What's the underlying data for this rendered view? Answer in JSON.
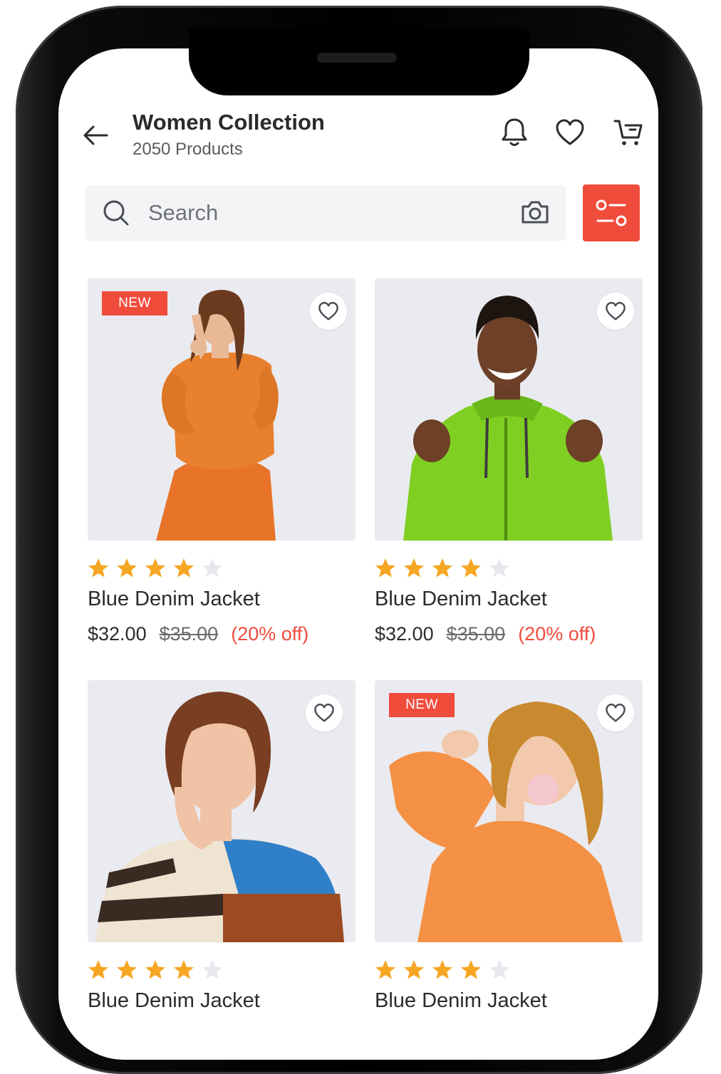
{
  "header": {
    "title": "Women Collection",
    "subtitle": "2050 Products",
    "icons": [
      "back-arrow-icon",
      "bell-icon",
      "heart-icon",
      "cart-icon"
    ]
  },
  "search": {
    "placeholder": "Search",
    "value": "",
    "icons": [
      "search-icon",
      "camera-icon",
      "filter-icon"
    ]
  },
  "colors": {
    "accent": "#f04c3c",
    "star": "#f6a623",
    "star_empty": "#e6e8ee",
    "card_bg": "#eaebf0"
  },
  "products": [
    {
      "badge": "NEW",
      "rating": 4,
      "name": "Blue Denim Jacket",
      "price": "$32.00",
      "old_price": "$35.00",
      "discount": "(20% off)",
      "image": "woman-orange-sweater"
    },
    {
      "badge": "",
      "rating": 4,
      "name": "Blue Denim Jacket",
      "price": "$32.00",
      "old_price": "$35.00",
      "discount": "(20% off)",
      "image": "man-green-hoodie"
    },
    {
      "badge": "",
      "rating": 4,
      "name": "Blue Denim Jacket",
      "price": "",
      "old_price": "",
      "discount": "",
      "image": "woman-striped-sweater"
    },
    {
      "badge": "NEW",
      "rating": 4,
      "name": "Blue Denim Jacket",
      "price": "",
      "old_price": "",
      "discount": "",
      "image": "woman-orange-sweatshirt"
    }
  ]
}
